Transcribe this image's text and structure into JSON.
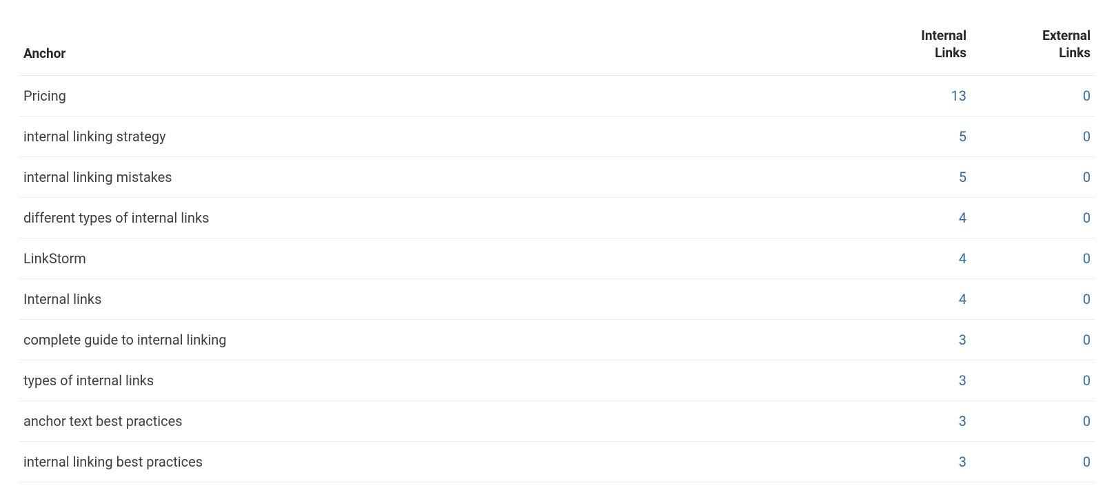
{
  "table": {
    "headers": {
      "anchor": "Anchor",
      "internal_l1": "Internal",
      "internal_l2": "Links",
      "external_l1": "External",
      "external_l2": "Links"
    },
    "rows": [
      {
        "anchor": "Pricing",
        "internal": "13",
        "external": "0"
      },
      {
        "anchor": "internal linking strategy",
        "internal": "5",
        "external": "0"
      },
      {
        "anchor": "internal linking mistakes",
        "internal": "5",
        "external": "0"
      },
      {
        "anchor": "different types of internal links",
        "internal": "4",
        "external": "0"
      },
      {
        "anchor": "LinkStorm",
        "internal": "4",
        "external": "0"
      },
      {
        "anchor": "Internal links",
        "internal": "4",
        "external": "0"
      },
      {
        "anchor": "complete guide to internal linking",
        "internal": "3",
        "external": "0"
      },
      {
        "anchor": "types of internal links",
        "internal": "3",
        "external": "0"
      },
      {
        "anchor": "anchor text best practices",
        "internal": "3",
        "external": "0"
      },
      {
        "anchor": "internal linking best practices",
        "internal": "3",
        "external": "0"
      }
    ]
  }
}
